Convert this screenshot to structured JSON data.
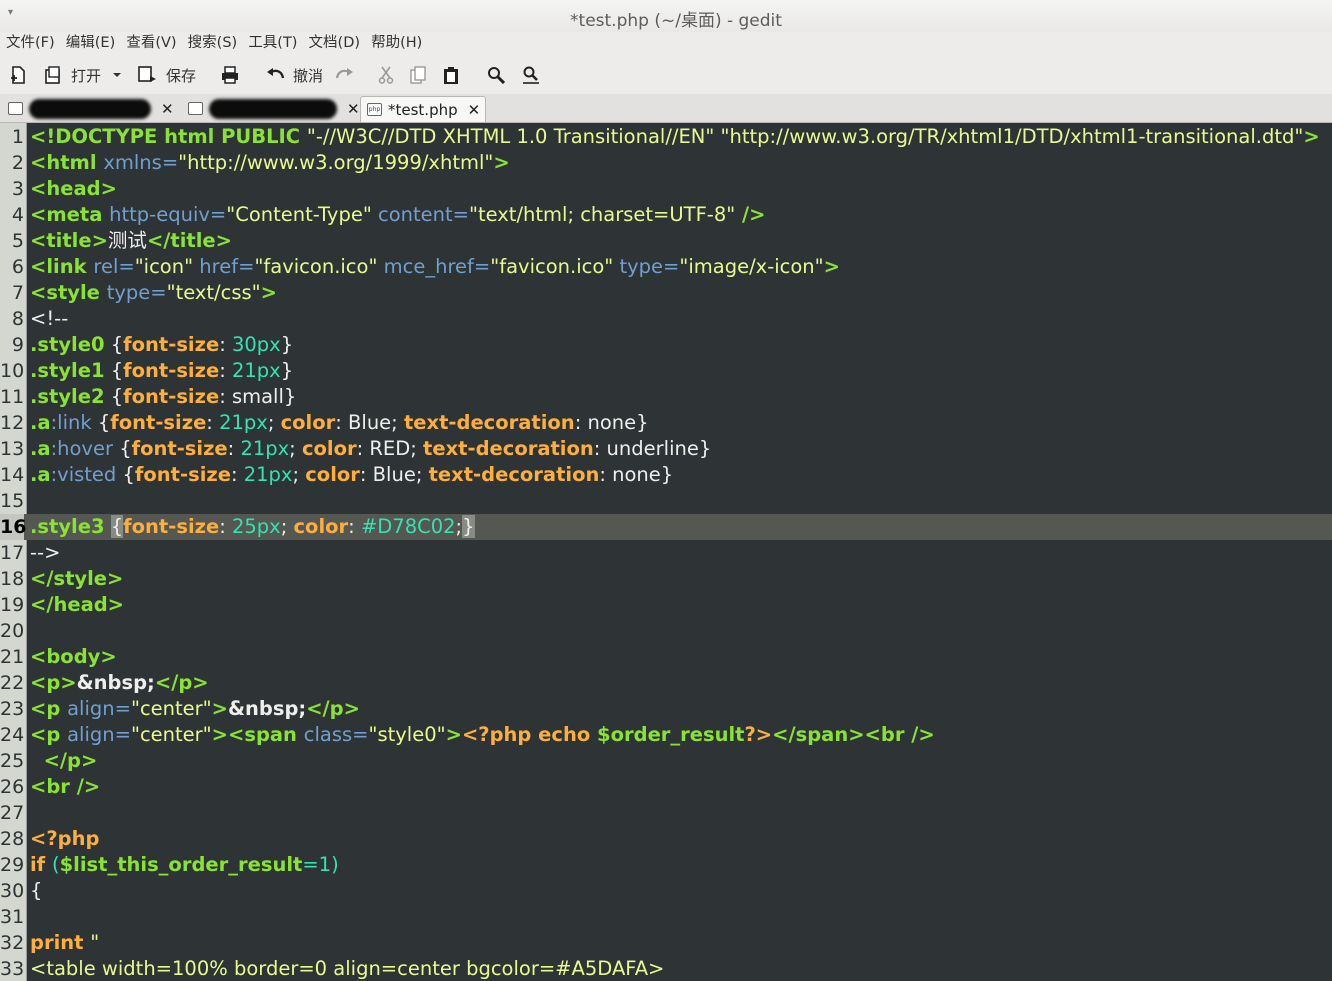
{
  "window": {
    "title": "*test.php (~/桌面) - gedit",
    "menu_glyph": "▾"
  },
  "menubar": {
    "items": [
      "文件(F)",
      "编辑(E)",
      "查看(V)",
      "搜索(S)",
      "工具(T)",
      "文档(D)",
      "帮助(H)"
    ]
  },
  "toolbar": {
    "open_label": "打开",
    "save_label": "保存",
    "undo_label": "撤消"
  },
  "tabs": [
    {
      "label": "",
      "redacted": true,
      "close": "✕"
    },
    {
      "label": "",
      "redacted": true,
      "close": "✕"
    },
    {
      "label": "*test.php",
      "active": true,
      "close": "✕",
      "icon_text": "php"
    }
  ],
  "editor": {
    "current_line": 16,
    "colors": {
      "background": "#2e3436",
      "gutter": "#d3d7cf",
      "current_line": "#555753"
    },
    "lines": [
      [
        [
          "t-tag",
          "<!DOCTYPE html PUBLIC "
        ],
        [
          "t-qstr",
          "\"-//W3C//DTD XHTML 1.0 Transitional//EN\" \"http://www.w3.org/TR/xhtml1/DTD/xhtml1-transitional.dtd\""
        ],
        [
          "t-tag",
          ">"
        ]
      ],
      [
        [
          "t-tag",
          "<html "
        ],
        [
          "t-attr",
          "xmlns="
        ],
        [
          "t-qstr",
          "\"http://www.w3.org/1999/xhtml\""
        ],
        [
          "t-tag",
          ">"
        ]
      ],
      [
        [
          "t-tag",
          "<head>"
        ]
      ],
      [
        [
          "t-tag",
          "<meta "
        ],
        [
          "t-attr",
          "http-equiv="
        ],
        [
          "t-qstr",
          "\"Content-Type\""
        ],
        [
          "t-plain",
          " "
        ],
        [
          "t-attr",
          "content="
        ],
        [
          "t-qstr",
          "\"text/html; charset=UTF-8\""
        ],
        [
          "t-tag",
          " />"
        ]
      ],
      [
        [
          "t-tag",
          "<title>"
        ],
        [
          "t-plain",
          "测试"
        ],
        [
          "t-tag",
          "</title>"
        ]
      ],
      [
        [
          "t-tag",
          "<link "
        ],
        [
          "t-attr",
          "rel="
        ],
        [
          "t-qstr",
          "\"icon\""
        ],
        [
          "t-plain",
          " "
        ],
        [
          "t-attr",
          "href="
        ],
        [
          "t-qstr",
          "\"favicon.ico\""
        ],
        [
          "t-plain",
          " "
        ],
        [
          "t-attr",
          "mce_href="
        ],
        [
          "t-qstr",
          "\"favicon.ico\""
        ],
        [
          "t-plain",
          " "
        ],
        [
          "t-attr",
          "type="
        ],
        [
          "t-qstr",
          "\"image/x-icon\""
        ],
        [
          "t-tag",
          ">"
        ]
      ],
      [
        [
          "t-tag",
          "<style "
        ],
        [
          "t-attr",
          "type="
        ],
        [
          "t-qstr",
          "\"text/css\""
        ],
        [
          "t-tag",
          ">"
        ]
      ],
      [
        [
          "t-plain",
          "<!--"
        ]
      ],
      [
        [
          "t-sel",
          ".style0"
        ],
        [
          "t-plain",
          " {"
        ],
        [
          "t-prop",
          "font-size"
        ],
        [
          "t-plain",
          ": "
        ],
        [
          "t-num",
          "30px"
        ],
        [
          "t-plain",
          "}"
        ]
      ],
      [
        [
          "t-sel",
          ".style1"
        ],
        [
          "t-plain",
          " {"
        ],
        [
          "t-prop",
          "font-size"
        ],
        [
          "t-plain",
          ": "
        ],
        [
          "t-num",
          "21px"
        ],
        [
          "t-plain",
          "}"
        ]
      ],
      [
        [
          "t-sel",
          ".style2"
        ],
        [
          "t-plain",
          " {"
        ],
        [
          "t-prop",
          "font-size"
        ],
        [
          "t-plain",
          ": small}"
        ]
      ],
      [
        [
          "t-sel",
          ".a"
        ],
        [
          "t-pseudo",
          ":link"
        ],
        [
          "t-plain",
          " {"
        ],
        [
          "t-prop",
          "font-size"
        ],
        [
          "t-plain",
          ": "
        ],
        [
          "t-num",
          "21px"
        ],
        [
          "t-plain",
          "; "
        ],
        [
          "t-prop",
          "color"
        ],
        [
          "t-plain",
          ": Blue; "
        ],
        [
          "t-prop",
          "text-decoration"
        ],
        [
          "t-plain",
          ": none}"
        ]
      ],
      [
        [
          "t-sel",
          ".a"
        ],
        [
          "t-pseudo",
          ":hover"
        ],
        [
          "t-plain",
          " {"
        ],
        [
          "t-prop",
          "font-size"
        ],
        [
          "t-plain",
          ": "
        ],
        [
          "t-num",
          "21px"
        ],
        [
          "t-plain",
          "; "
        ],
        [
          "t-prop",
          "color"
        ],
        [
          "t-plain",
          ": RED; "
        ],
        [
          "t-prop",
          "text-decoration"
        ],
        [
          "t-plain",
          ": underline}"
        ]
      ],
      [
        [
          "t-sel",
          ".a"
        ],
        [
          "t-pseudo",
          ":visted"
        ],
        [
          "t-plain",
          " {"
        ],
        [
          "t-prop",
          "font-size"
        ],
        [
          "t-plain",
          ": "
        ],
        [
          "t-num",
          "21px"
        ],
        [
          "t-plain",
          "; "
        ],
        [
          "t-prop",
          "color"
        ],
        [
          "t-plain",
          ": Blue; "
        ],
        [
          "t-prop",
          "text-decoration"
        ],
        [
          "t-plain",
          ": none}"
        ]
      ],
      [],
      [
        [
          "t-sel",
          ".style3"
        ],
        [
          "t-plain",
          " "
        ],
        [
          "t-bracket-hl",
          "{"
        ],
        [
          "t-prop",
          "font-size"
        ],
        [
          "t-plain",
          ": "
        ],
        [
          "t-num",
          "25px"
        ],
        [
          "t-plain",
          "; "
        ],
        [
          "t-prop",
          "color"
        ],
        [
          "t-plain",
          ": "
        ],
        [
          "t-num",
          "#D78C02"
        ],
        [
          "t-plain",
          ";"
        ],
        [
          "t-bracket-hl",
          "}"
        ]
      ],
      [
        [
          "t-plain",
          "-->"
        ]
      ],
      [
        [
          "t-tag",
          "</style>"
        ]
      ],
      [
        [
          "t-tag",
          "</head>"
        ]
      ],
      [],
      [
        [
          "t-tag",
          "<body>"
        ]
      ],
      [
        [
          "t-tag",
          "<p>"
        ],
        [
          "t-ent",
          "&nbsp;"
        ],
        [
          "t-tag",
          "</p>"
        ]
      ],
      [
        [
          "t-tag",
          "<p "
        ],
        [
          "t-attr",
          "align="
        ],
        [
          "t-qstr",
          "\"center\""
        ],
        [
          "t-tag",
          ">"
        ],
        [
          "t-ent",
          "&nbsp;"
        ],
        [
          "t-tag",
          "</p>"
        ]
      ],
      [
        [
          "t-tag",
          "<p "
        ],
        [
          "t-attr",
          "align="
        ],
        [
          "t-qstr",
          "\"center\""
        ],
        [
          "t-tag",
          "><span "
        ],
        [
          "t-attr",
          "class="
        ],
        [
          "t-qstr",
          "\"style0\""
        ],
        [
          "t-tag",
          ">"
        ],
        [
          "t-php",
          "<?php echo "
        ],
        [
          "t-var",
          "$order_result"
        ],
        [
          "t-php",
          "?>"
        ],
        [
          "t-tag",
          "</span><br />"
        ]
      ],
      [
        [
          "t-tag",
          "  </p>"
        ]
      ],
      [
        [
          "t-tag",
          "<br />"
        ]
      ],
      [],
      [
        [
          "t-php",
          "<?php"
        ]
      ],
      [
        [
          "t-php",
          "if "
        ],
        [
          "t-paren",
          "("
        ],
        [
          "t-var",
          "$list_this_order_result"
        ],
        [
          "t-paren",
          "=1)"
        ]
      ],
      [
        [
          "t-plain",
          "{"
        ]
      ],
      [],
      [
        [
          "t-php",
          "print "
        ],
        [
          "t-qstr",
          "\""
        ]
      ],
      [
        [
          "t-qstr",
          "<table width=100% border=0 align=center bgcolor=#A5DAFA>"
        ]
      ]
    ]
  }
}
